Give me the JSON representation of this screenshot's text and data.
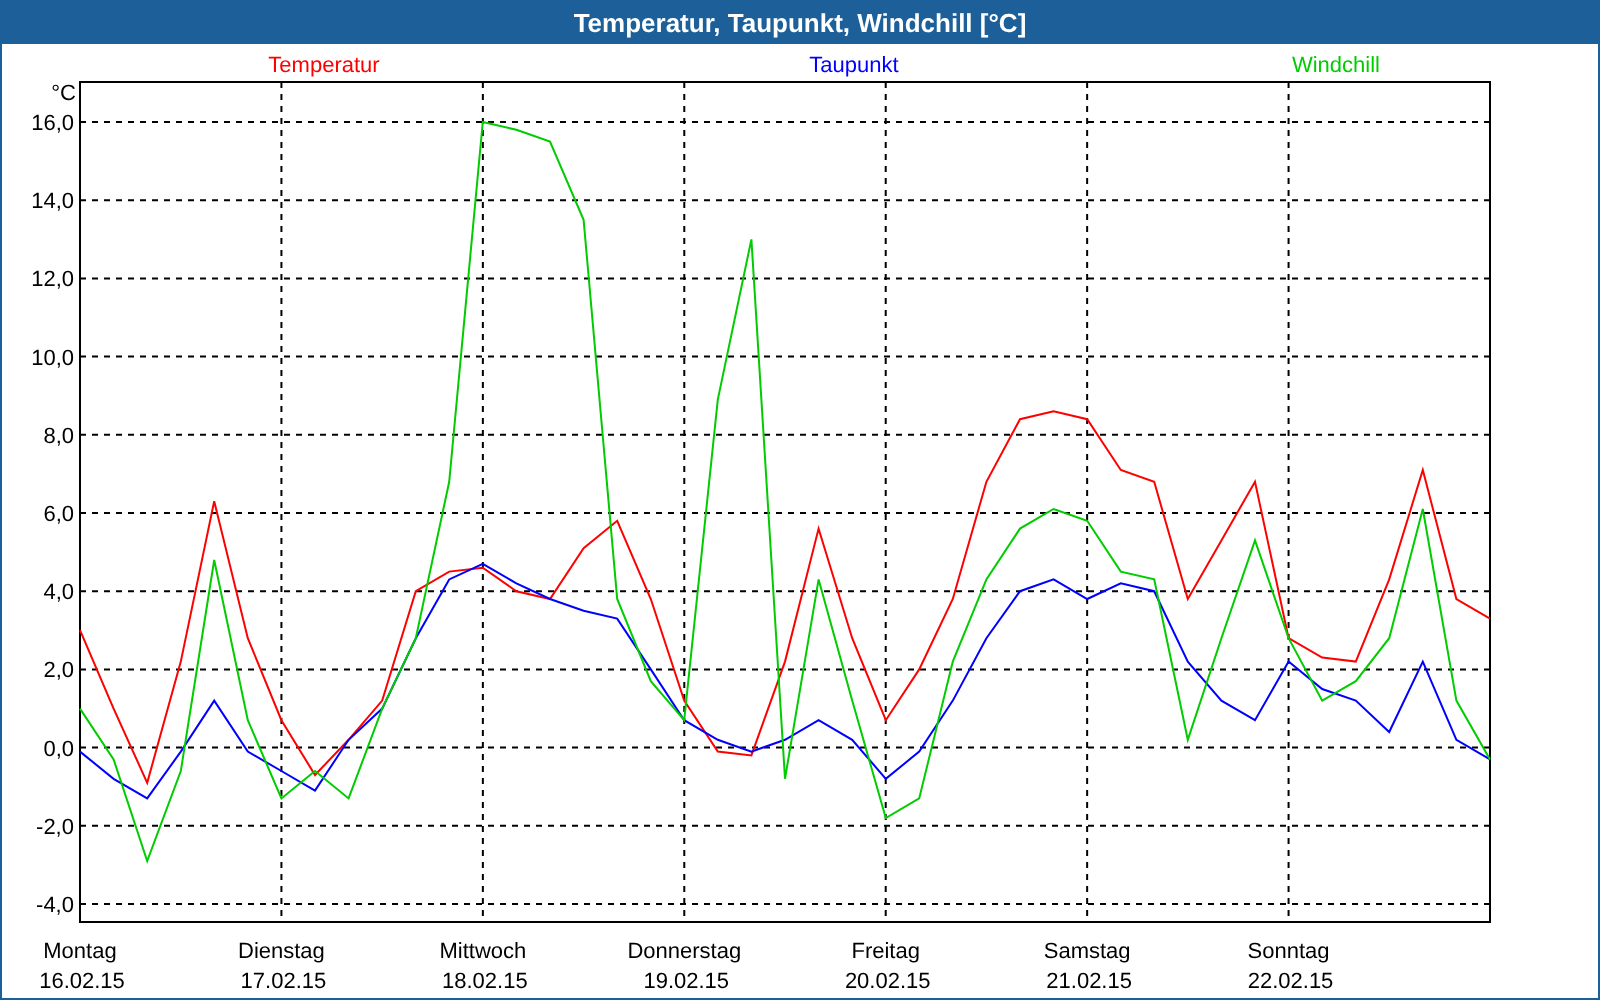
{
  "window": {
    "title": "Temperatur, Taupunkt, Windchill [°C]"
  },
  "chart": {
    "dates": [
      "16.02.15",
      "17.02.15",
      "18.02.15",
      "19.02.15",
      "20.02.15",
      "21.02.15",
      "22.02.15"
    ],
    "chart_data": {
      "type": "line",
      "ylabel": "°C",
      "grid": true,
      "ylim": [
        -4,
        16
      ],
      "categories": [
        "Montag",
        null,
        null,
        null,
        null,
        null,
        "Dienstag",
        null,
        null,
        null,
        null,
        null,
        "Mittwoch",
        null,
        null,
        null,
        null,
        null,
        "Donnerstag",
        null,
        null,
        null,
        null,
        null,
        "Freitag",
        null,
        null,
        null,
        null,
        null,
        "Samstag",
        null,
        null,
        null,
        null,
        null,
        "Sonntag",
        null,
        null,
        null,
        null,
        null,
        null
      ],
      "yticks": [
        {
          "value": 16,
          "label": "16,0"
        },
        {
          "value": 14,
          "label": "14,0"
        },
        {
          "value": 12,
          "label": "12,0"
        },
        {
          "value": 10,
          "label": "10,0"
        },
        {
          "value": 8,
          "label": "8,0"
        },
        {
          "value": 6,
          "label": "6,0"
        },
        {
          "value": 4,
          "label": "4,0"
        },
        {
          "value": 2,
          "label": "2,0"
        },
        {
          "value": 0,
          "label": "0,0"
        },
        {
          "value": -2,
          "label": "-2,0"
        },
        {
          "value": -4,
          "label": "-4,0"
        }
      ],
      "series": [
        {
          "name": "Temperatur",
          "color": "#ff0000",
          "values": [
            3.0,
            1.0,
            -0.9,
            2.2,
            6.3,
            2.8,
            0.7,
            -0.7,
            0.2,
            1.2,
            4.0,
            4.5,
            4.6,
            4.0,
            3.8,
            5.1,
            5.8,
            3.8,
            1.2,
            -0.1,
            -0.2,
            2.2,
            5.6,
            2.8,
            0.7,
            2.0,
            3.8,
            6.8,
            8.4,
            8.6,
            8.4,
            7.1,
            6.8,
            3.8,
            5.3,
            6.8,
            2.8,
            2.3,
            2.2,
            4.3,
            7.1,
            3.8,
            3.3
          ]
        },
        {
          "name": "Taupunkt",
          "color": "#0000ff",
          "values": [
            -0.1,
            -0.8,
            -1.3,
            -0.1,
            1.2,
            -0.1,
            -0.6,
            -1.1,
            0.2,
            1.0,
            2.8,
            4.3,
            4.7,
            4.2,
            3.8,
            3.5,
            3.3,
            2.0,
            0.7,
            0.2,
            -0.1,
            0.2,
            0.7,
            0.2,
            -0.8,
            -0.1,
            1.2,
            2.8,
            4.0,
            4.3,
            3.8,
            4.2,
            4.0,
            2.2,
            1.2,
            0.7,
            2.2,
            1.5,
            1.2,
            0.4,
            2.2,
            0.2,
            -0.3
          ]
        },
        {
          "name": "Windchill",
          "color": "#00cc00",
          "values": [
            1.0,
            -0.3,
            -2.9,
            -0.6,
            4.8,
            0.7,
            -1.3,
            -0.6,
            -1.3,
            1.0,
            2.8,
            6.8,
            16.0,
            15.8,
            15.5,
            13.5,
            3.8,
            1.7,
            0.7,
            8.9,
            13.0,
            -0.8,
            4.3,
            1.2,
            -1.8,
            -1.3,
            2.2,
            4.3,
            5.6,
            6.1,
            5.8,
            4.5,
            4.3,
            0.2,
            2.8,
            5.3,
            2.8,
            1.2,
            1.7,
            2.8,
            6.1,
            1.2,
            -0.3
          ]
        }
      ]
    }
  }
}
